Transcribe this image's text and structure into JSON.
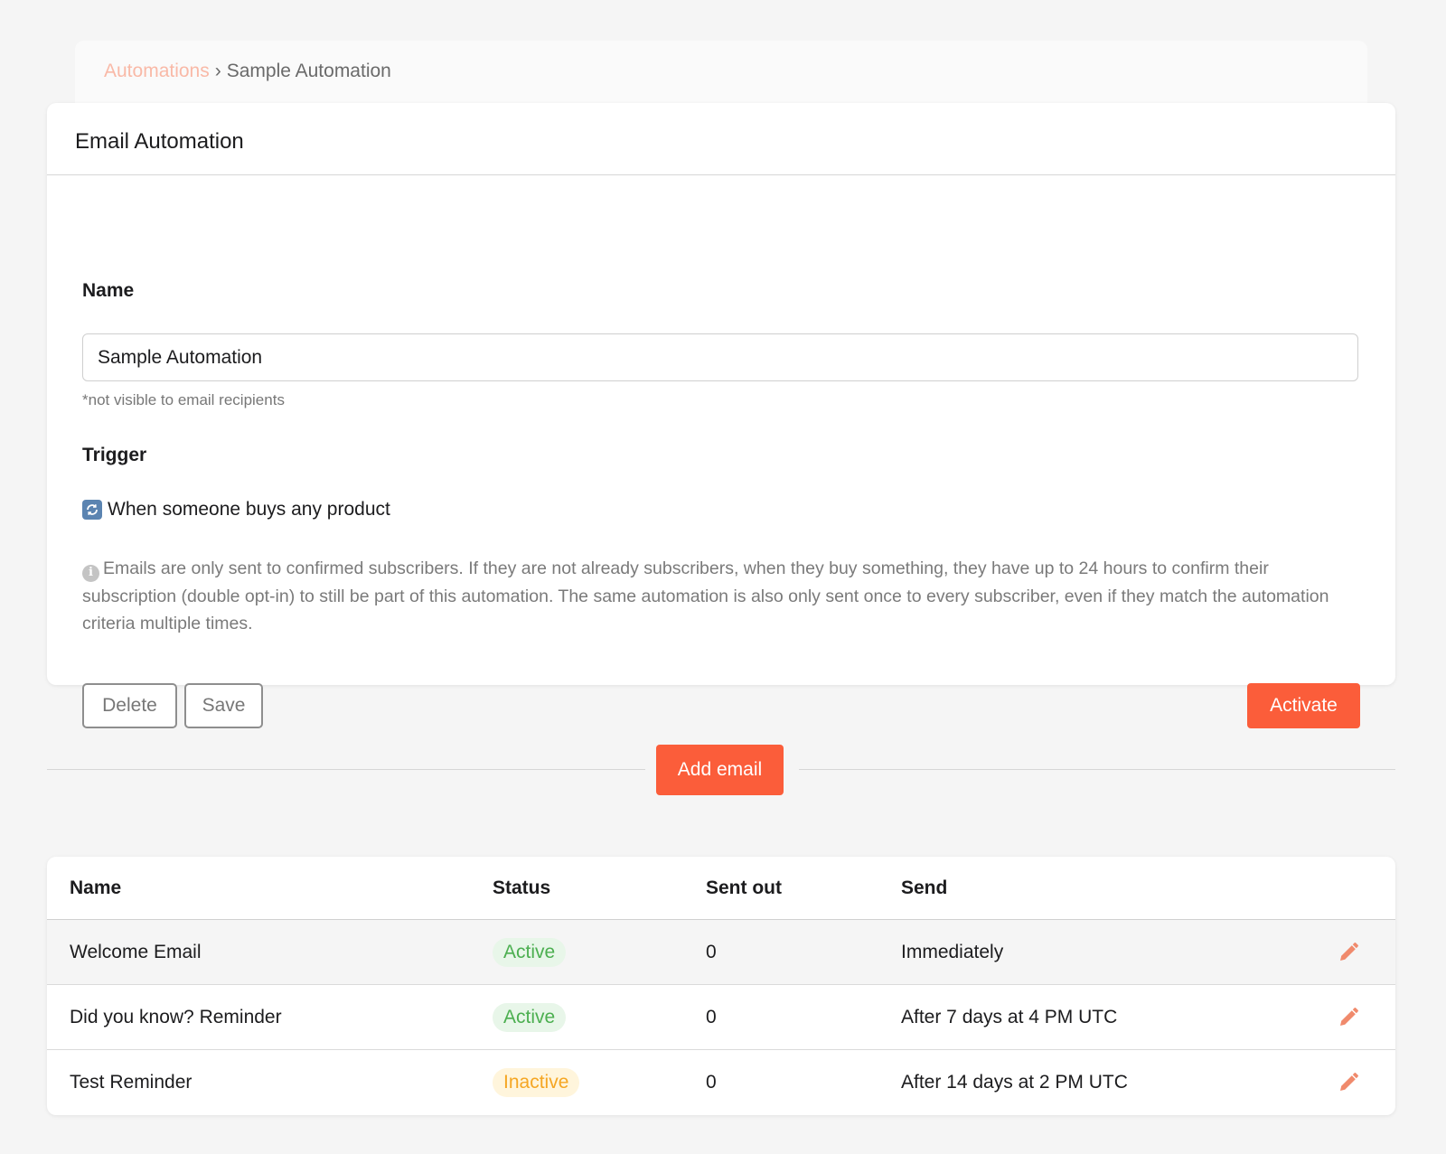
{
  "breadcrumb": {
    "parent": "Automations",
    "separator": "›",
    "current": "Sample Automation"
  },
  "card": {
    "title": "Email Automation",
    "name_label": "Name",
    "name_value": "Sample Automation",
    "name_hint": "*not visible to email recipients",
    "trigger_label": "Trigger",
    "trigger_text": "When someone buys any product",
    "trigger_icon": "refresh-icon",
    "info_icon": "info-icon",
    "info_text": "Emails are only sent to confirmed subscribers. If they are not already subscribers, when they buy something, they have up to 24 hours to confirm their subscription (double opt-in) to still be part of this automation. The same automation is also only sent once to every subscriber, even if they match the automation criteria multiple times.",
    "delete_label": "Delete",
    "save_label": "Save",
    "activate_label": "Activate"
  },
  "add_email_label": "Add email",
  "table": {
    "columns": [
      "Name",
      "Status",
      "Sent out",
      "Send"
    ],
    "rows": [
      {
        "name": "Welcome Email",
        "status": "Active",
        "sent_out": "0",
        "send": "Immediately"
      },
      {
        "name": "Did you know? Reminder",
        "status": "Active",
        "sent_out": "0",
        "send": "After 7 days at 4 PM UTC"
      },
      {
        "name": "Test Reminder",
        "status": "Inactive",
        "sent_out": "0",
        "send": "After 14 days at 2 PM UTC"
      }
    ],
    "edit_icon": "pencil-icon"
  },
  "colors": {
    "accent": "#fb5d3a",
    "active": "#4caf50",
    "inactive": "#f5a623",
    "edit_icon": "#f08a6c"
  }
}
